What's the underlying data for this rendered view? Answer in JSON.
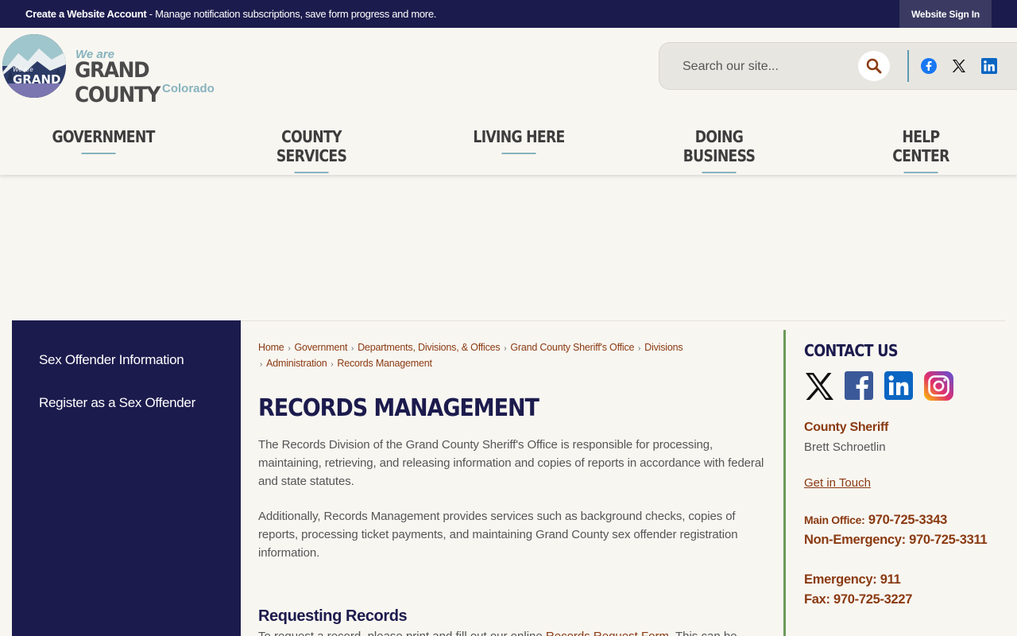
{
  "topbar": {
    "create_account": "Create a Website Account",
    "message": " - Manage notification subscriptions, save form progress and more.",
    "signin": "Website Sign In"
  },
  "logo": {
    "we_are": "We are",
    "name": "GRAND COUNTY",
    "state": "Colorado",
    "badge_we": "We are",
    "badge_grand": "GRAND"
  },
  "search": {
    "placeholder": "Search our site..."
  },
  "nav": {
    "items": [
      "GOVERNMENT",
      "COUNTY SERVICES",
      "LIVING HERE",
      "DOING BUSINESS",
      "HELP CENTER"
    ]
  },
  "sidebar": {
    "items": [
      "Sex Offender Information",
      "Register as a Sex Offender"
    ]
  },
  "breadcrumb": {
    "items": [
      "Home",
      "Government",
      "Departments, Divisions, & Offices",
      "Grand County Sheriff's Office",
      "Divisions",
      "Administration",
      "Records Management"
    ]
  },
  "main": {
    "title": "RECORDS MANAGEMENT",
    "para1": "The Records Division of the Grand County Sheriff's Office is responsible for processing, maintaining, retrieving, and releasing information and copies of reports in accordance with federal and state statutes.",
    "para2": "Additionally, Records Management provides services such as background checks, copies of reports, processing ticket payments, and maintaining Grand County sex offender registration information.",
    "subhead": "Requesting Records",
    "para3_start": "To request a record, please print and fill out our online ",
    "para3_link": "Records Request Form",
    "para3_end": ". This can be"
  },
  "contact": {
    "title": "CONTACT US",
    "role": "County Sheriff",
    "name": "Brett Schroetlin",
    "link": "Get in Touch",
    "main_label": "Main Office:",
    "main_phone": "970-725-3343",
    "nonemergency": "Non-Emergency: 970-725-3311",
    "emergency": "Emergency: 911",
    "fax": "Fax: 970-725-3227"
  },
  "colors": {
    "navy": "#1c1b4d",
    "accent_teal": "#86b3be",
    "link_brown": "#8a3a12",
    "contact_border": "#6b9a5a"
  }
}
